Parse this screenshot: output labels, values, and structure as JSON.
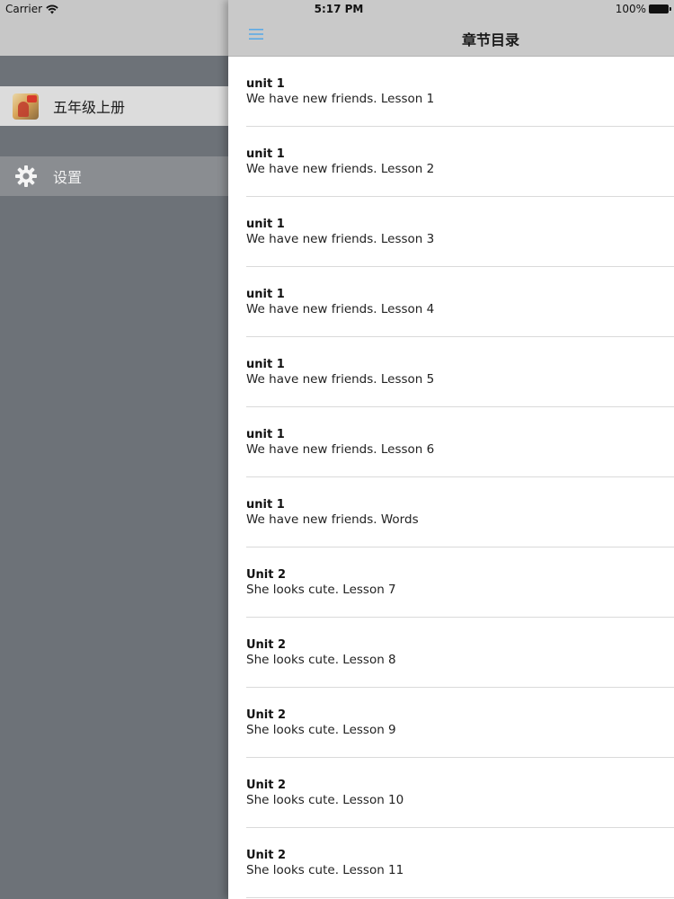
{
  "status_bar": {
    "carrier": "Carrier",
    "time": "5:17 PM",
    "battery": "100%"
  },
  "drawer": {
    "items": [
      {
        "label": "五年级上册",
        "icon": "book-cover-icon"
      },
      {
        "label": "设置",
        "icon": "gear-icon"
      }
    ]
  },
  "navbar": {
    "title": "章节目录",
    "menu_icon": "hamburger-menu-icon",
    "accent_color": "#5aa9e6"
  },
  "chapters": [
    {
      "unit": "unit 1",
      "lesson": "We have new friends. Lesson 1"
    },
    {
      "unit": "unit 1",
      "lesson": "We have new friends. Lesson 2"
    },
    {
      "unit": "unit 1",
      "lesson": "We have new friends. Lesson 3"
    },
    {
      "unit": "unit 1",
      "lesson": "We have new friends. Lesson 4"
    },
    {
      "unit": "unit 1",
      "lesson": "We have new friends. Lesson 5"
    },
    {
      "unit": "unit 1",
      "lesson": "We have new friends. Lesson 6"
    },
    {
      "unit": "unit 1",
      "lesson": "We have new friends. Words"
    },
    {
      "unit": "Unit 2",
      "lesson": "She looks cute. Lesson 7"
    },
    {
      "unit": "Unit 2",
      "lesson": "She looks cute. Lesson 8"
    },
    {
      "unit": "Unit 2",
      "lesson": "She looks cute. Lesson 9"
    },
    {
      "unit": "Unit 2",
      "lesson": "She looks cute. Lesson 10"
    },
    {
      "unit": "Unit 2",
      "lesson": "She looks cute. Lesson 11"
    }
  ]
}
